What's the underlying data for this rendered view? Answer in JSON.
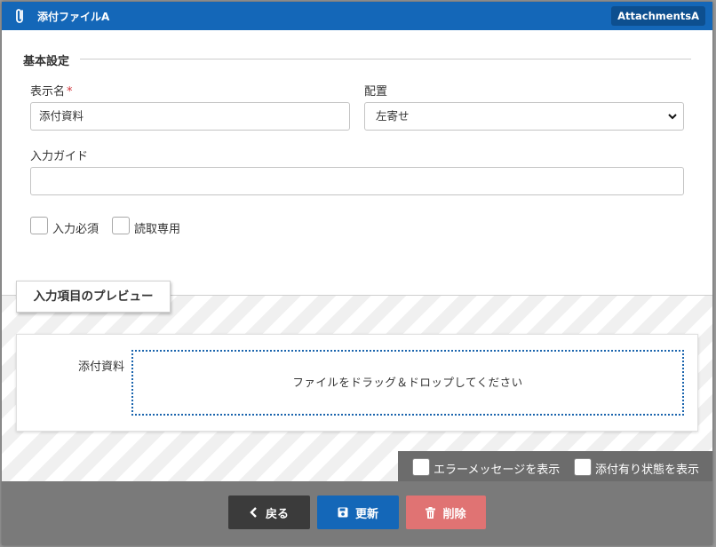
{
  "titlebar": {
    "title": "添付ファイルA",
    "badge": "AttachmentsA"
  },
  "basic_settings": {
    "section_title": "基本設定",
    "display_name": {
      "label": "表示名",
      "required_mark": "*",
      "value": "添付資料"
    },
    "alignment": {
      "label": "配置",
      "selected": "左寄せ"
    },
    "input_guide": {
      "label": "入力ガイド",
      "value": ""
    },
    "checkboxes": [
      {
        "label": "入力必須",
        "checked": false
      },
      {
        "label": "読取専用",
        "checked": false
      }
    ]
  },
  "preview": {
    "tab_label": "入力項目のプレビュー",
    "field_label": "添付資料",
    "dropzone_text": "ファイルをドラッグ＆ドロップしてください",
    "options": [
      {
        "label": "エラーメッセージを表示",
        "checked": false
      },
      {
        "label": "添付有り状態を表示",
        "checked": false
      }
    ]
  },
  "footer": {
    "back_label": "戻る",
    "update_label": "更新",
    "delete_label": "削除"
  },
  "colors": {
    "primary": "#1467b8",
    "danger": "#e07373",
    "dark": "#3b3b3b",
    "required": "#d0343b"
  }
}
